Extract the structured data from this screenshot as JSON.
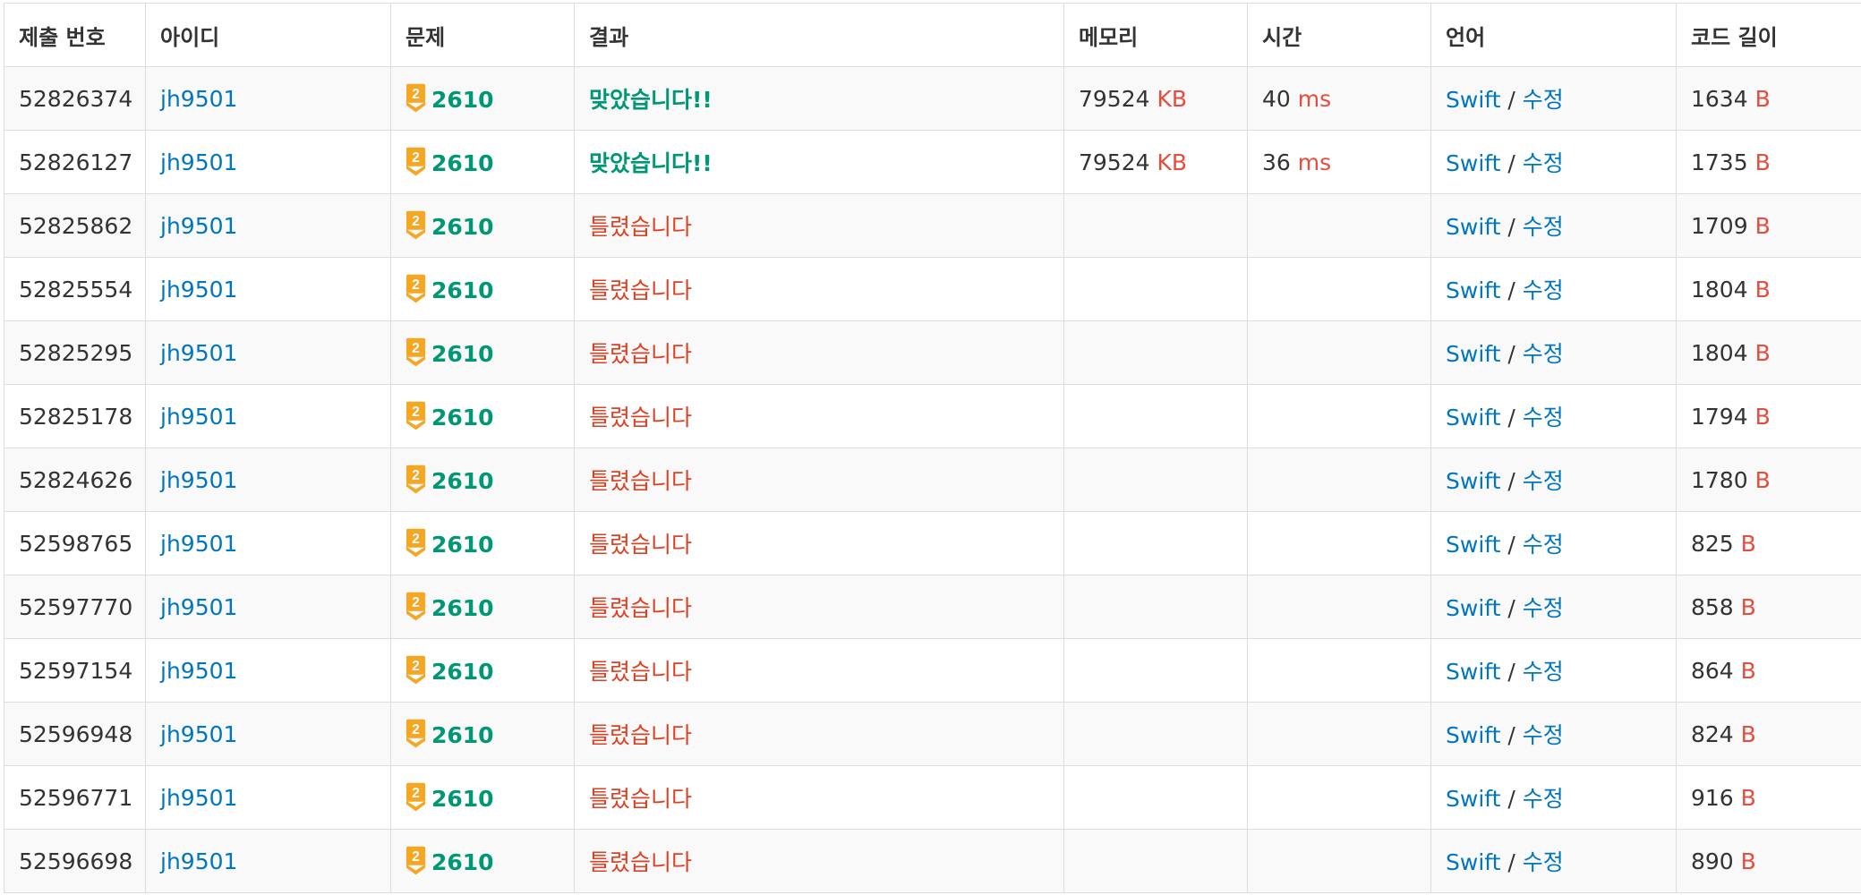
{
  "headers": [
    "제출 번호",
    "아이디",
    "문제",
    "결과",
    "메모리",
    "시간",
    "언어",
    "코드 길이"
  ],
  "accent_colors": {
    "link": "#0076c0",
    "accepted": "#009874",
    "wrong": "#dd4124",
    "unit": "#e74c3c",
    "tier_gold": "#f5a623"
  },
  "rows": [
    {
      "id": "52826374",
      "user": "jh9501",
      "tier": "2",
      "problem": "2610",
      "result": "맞았습니다!!",
      "result_type": "accepted",
      "memory": "79524",
      "memory_unit": "KB",
      "time": "40",
      "time_unit": "ms",
      "lang": "Swift",
      "sep": "/",
      "edit": "수정",
      "length": "1634",
      "length_unit": "B"
    },
    {
      "id": "52826127",
      "user": "jh9501",
      "tier": "2",
      "problem": "2610",
      "result": "맞았습니다!!",
      "result_type": "accepted",
      "memory": "79524",
      "memory_unit": "KB",
      "time": "36",
      "time_unit": "ms",
      "lang": "Swift",
      "sep": "/",
      "edit": "수정",
      "length": "1735",
      "length_unit": "B"
    },
    {
      "id": "52825862",
      "user": "jh9501",
      "tier": "2",
      "problem": "2610",
      "result": "틀렸습니다",
      "result_type": "wrong",
      "memory": "",
      "memory_unit": "",
      "time": "",
      "time_unit": "",
      "lang": "Swift",
      "sep": "/",
      "edit": "수정",
      "length": "1709",
      "length_unit": "B"
    },
    {
      "id": "52825554",
      "user": "jh9501",
      "tier": "2",
      "problem": "2610",
      "result": "틀렸습니다",
      "result_type": "wrong",
      "memory": "",
      "memory_unit": "",
      "time": "",
      "time_unit": "",
      "lang": "Swift",
      "sep": "/",
      "edit": "수정",
      "length": "1804",
      "length_unit": "B"
    },
    {
      "id": "52825295",
      "user": "jh9501",
      "tier": "2",
      "problem": "2610",
      "result": "틀렸습니다",
      "result_type": "wrong",
      "memory": "",
      "memory_unit": "",
      "time": "",
      "time_unit": "",
      "lang": "Swift",
      "sep": "/",
      "edit": "수정",
      "length": "1804",
      "length_unit": "B"
    },
    {
      "id": "52825178",
      "user": "jh9501",
      "tier": "2",
      "problem": "2610",
      "result": "틀렸습니다",
      "result_type": "wrong",
      "memory": "",
      "memory_unit": "",
      "time": "",
      "time_unit": "",
      "lang": "Swift",
      "sep": "/",
      "edit": "수정",
      "length": "1794",
      "length_unit": "B"
    },
    {
      "id": "52824626",
      "user": "jh9501",
      "tier": "2",
      "problem": "2610",
      "result": "틀렸습니다",
      "result_type": "wrong",
      "memory": "",
      "memory_unit": "",
      "time": "",
      "time_unit": "",
      "lang": "Swift",
      "sep": "/",
      "edit": "수정",
      "length": "1780",
      "length_unit": "B"
    },
    {
      "id": "52598765",
      "user": "jh9501",
      "tier": "2",
      "problem": "2610",
      "result": "틀렸습니다",
      "result_type": "wrong",
      "memory": "",
      "memory_unit": "",
      "time": "",
      "time_unit": "",
      "lang": "Swift",
      "sep": "/",
      "edit": "수정",
      "length": "825",
      "length_unit": "B"
    },
    {
      "id": "52597770",
      "user": "jh9501",
      "tier": "2",
      "problem": "2610",
      "result": "틀렸습니다",
      "result_type": "wrong",
      "memory": "",
      "memory_unit": "",
      "time": "",
      "time_unit": "",
      "lang": "Swift",
      "sep": "/",
      "edit": "수정",
      "length": "858",
      "length_unit": "B"
    },
    {
      "id": "52597154",
      "user": "jh9501",
      "tier": "2",
      "problem": "2610",
      "result": "틀렸습니다",
      "result_type": "wrong",
      "memory": "",
      "memory_unit": "",
      "time": "",
      "time_unit": "",
      "lang": "Swift",
      "sep": "/",
      "edit": "수정",
      "length": "864",
      "length_unit": "B"
    },
    {
      "id": "52596948",
      "user": "jh9501",
      "tier": "2",
      "problem": "2610",
      "result": "틀렸습니다",
      "result_type": "wrong",
      "memory": "",
      "memory_unit": "",
      "time": "",
      "time_unit": "",
      "lang": "Swift",
      "sep": "/",
      "edit": "수정",
      "length": "824",
      "length_unit": "B"
    },
    {
      "id": "52596771",
      "user": "jh9501",
      "tier": "2",
      "problem": "2610",
      "result": "틀렸습니다",
      "result_type": "wrong",
      "memory": "",
      "memory_unit": "",
      "time": "",
      "time_unit": "",
      "lang": "Swift",
      "sep": "/",
      "edit": "수정",
      "length": "916",
      "length_unit": "B"
    },
    {
      "id": "52596698",
      "user": "jh9501",
      "tier": "2",
      "problem": "2610",
      "result": "틀렸습니다",
      "result_type": "wrong",
      "memory": "",
      "memory_unit": "",
      "time": "",
      "time_unit": "",
      "lang": "Swift",
      "sep": "/",
      "edit": "수정",
      "length": "890",
      "length_unit": "B"
    }
  ]
}
